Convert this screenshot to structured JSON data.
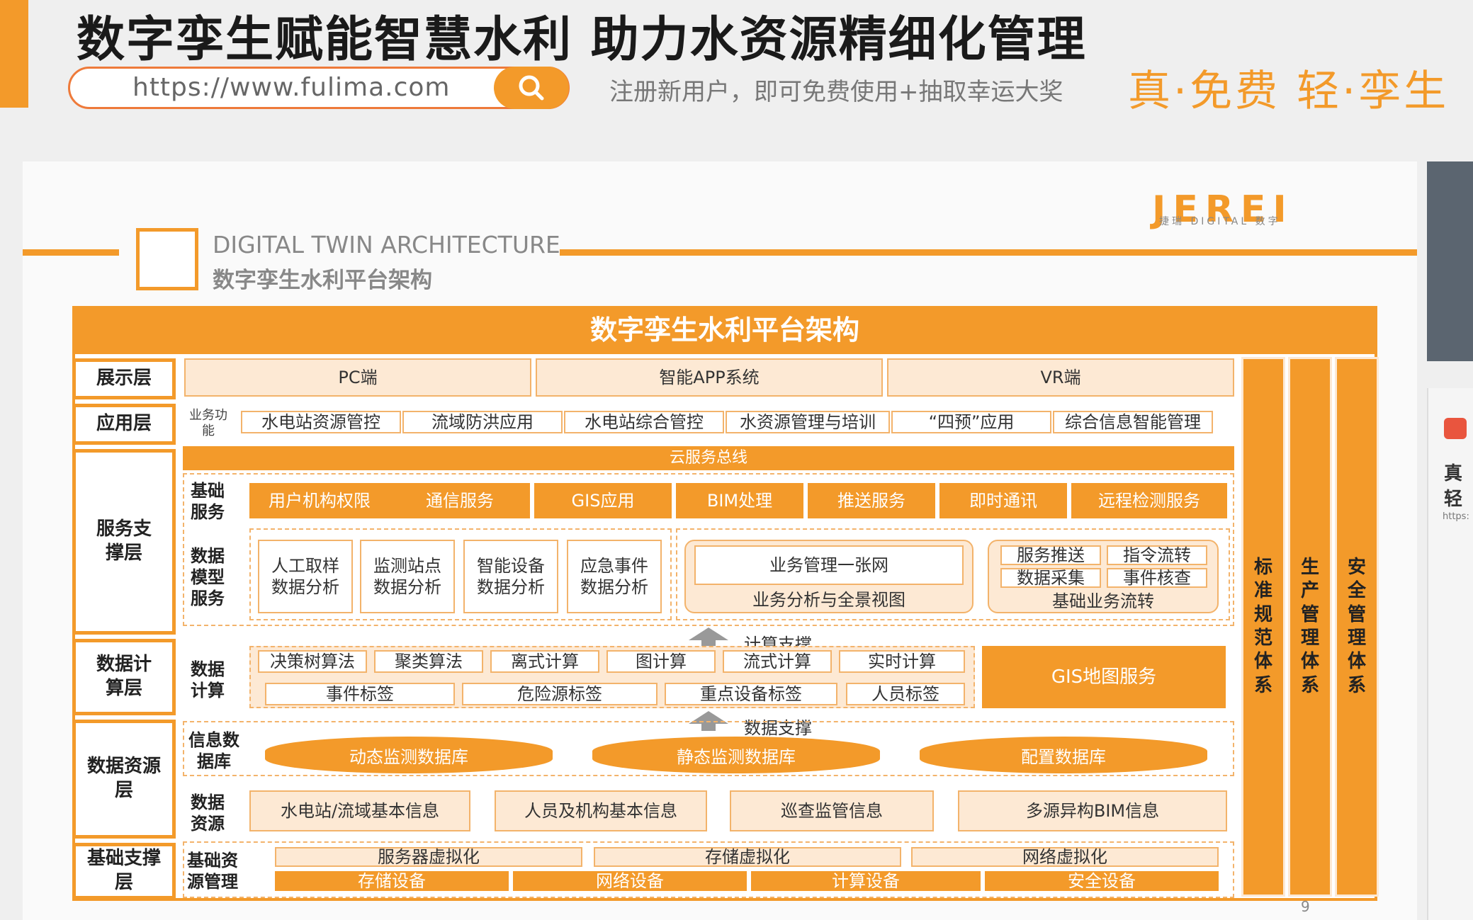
{
  "header": {
    "title": "数字孪生赋能智慧水利  助力水资源精细化管理",
    "search_url": "https://www.fulima.com",
    "tagline": "注册新用户，即可免费使用+抽取幸运大奖",
    "slogan": "真·免费 轻·孪生"
  },
  "slide": {
    "arch_en": "DIGITAL TWIN ARCHITECTURE",
    "arch_cn": "数字孪生水利平台架构",
    "logo": "JEREI",
    "logo_sub": "捷瑞 DIGITAL 数字",
    "page_number": "9"
  },
  "diagram": {
    "title": "数字孪生水利平台架构",
    "layers": [
      "展示层",
      "应用层",
      "服务支撑层",
      "数据计算层",
      "数据资源层",
      "基础支撑层"
    ],
    "presentation": [
      "PC端",
      "智能APP系统",
      "VR端"
    ],
    "app_label": "业务功能",
    "apps": [
      "水电站资源管控",
      "流域防洪应用",
      "水电站综合管控",
      "水资源管理与培训",
      "“四预”应用",
      "综合信息智能管理"
    ],
    "cloud_bus": "云服务总线",
    "basic_service_label": "基础服务",
    "basic_services": [
      "用户机构权限",
      "通信服务",
      "GIS应用",
      "BIM处理",
      "推送服务",
      "即时通讯",
      "远程检测服务"
    ],
    "model_label": "数据模型服务",
    "models": [
      "人工取样数据分析",
      "监测站点数据分析",
      "智能设备数据分析",
      "应急事件数据分析"
    ],
    "business_net": "业务管理一张网",
    "business_view": "业务分析与全景视图",
    "flow_items": [
      "服务推送",
      "指令流转",
      "数据采集",
      "事件核查"
    ],
    "flow_label": "基础业务流转",
    "compute_support": "计算支撑",
    "compute_label": "数据计算",
    "algos": [
      "决策树算法",
      "聚类算法",
      "离式计算",
      "图计算",
      "流式计算",
      "实时计算"
    ],
    "tags": [
      "事件标签",
      "危险源标签",
      "重点设备标签",
      "人员标签"
    ],
    "gis": "GIS地图服务",
    "data_support": "数据支撑",
    "db_label": "信息数据库",
    "dbs": [
      "动态监测数据库",
      "静态监测数据库",
      "配置数据库"
    ],
    "res_label": "数据资源",
    "resources": [
      "水电站/流域基本信息",
      "人员及机构基本信息",
      "巡查监管信息",
      "多源异构BIM信息"
    ],
    "infra_label": "基础资源管理",
    "virt": [
      "服务器虚拟化",
      "存储虚拟化",
      "网络虚拟化"
    ],
    "devices": [
      "存储设备",
      "网络设备",
      "计算设备",
      "安全设备"
    ],
    "side_systems": [
      "标准规范体系",
      "生产管理体系",
      "安全管理体系"
    ]
  },
  "right_panel": {
    "labels": [
      "真",
      "轻",
      "https:"
    ]
  }
}
